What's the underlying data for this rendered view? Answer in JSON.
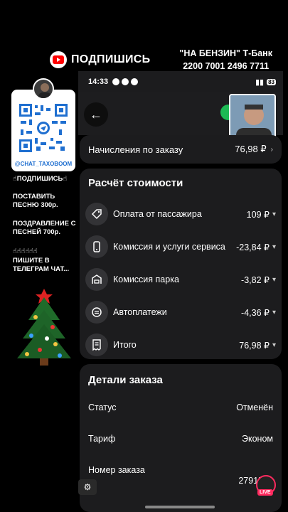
{
  "overlay": {
    "subscribe_label": "ПОДПИШИСЬ",
    "bank_line1": "\"НА БЕНЗИН\" Т-Банк",
    "bank_line2": "2200 7001 2496 7711",
    "qr_handle": "@CHAT_TAXOBOOM",
    "left_lines": [
      "☝ПОДПИШИСЬ☝",
      "ПОСТАВИТЬ ПЕСНЮ 300р.",
      "ПОЗДРАВЛЕНИЕ С ПЕСНЕЙ 700р.",
      "☝☝☝☝☝☝",
      "ПИШИТЕ В ТЕЛЕГРАМ ЧАТ..."
    ]
  },
  "status_bar": {
    "time": "14:33",
    "battery": "83"
  },
  "accrual": {
    "label": "Начисления по заказу",
    "value": "76,98 ₽"
  },
  "calc": {
    "title": "Расчёт стоимости",
    "rows": [
      {
        "label": "Оплата от пассажира",
        "value": "109 ₽",
        "icon": "tag-icon"
      },
      {
        "label": "Комиссия и услуги сервиса",
        "value": "-23,84 ₽",
        "icon": "phone-icon"
      },
      {
        "label": "Комиссия парка",
        "value": "-3,82 ₽",
        "icon": "car-park-icon"
      },
      {
        "label": "Автоплатежи",
        "value": "-4,36 ₽",
        "icon": "autopay-icon"
      },
      {
        "label": "Итого",
        "value": "76,98 ₽",
        "icon": "receipt-icon"
      }
    ]
  },
  "details": {
    "title": "Детали заказа",
    "rows": [
      {
        "label": "Статус",
        "value": "Отменён"
      },
      {
        "label": "Тариф",
        "value": "Эконом"
      },
      {
        "label": "Номер заказа",
        "value": "27915"
      }
    ]
  },
  "live_badge": "LIVE",
  "colors": {
    "card": "#1c1c1e",
    "icon_bg": "#333336",
    "accent_green": "#1db954",
    "live": "#ff2a5f"
  }
}
